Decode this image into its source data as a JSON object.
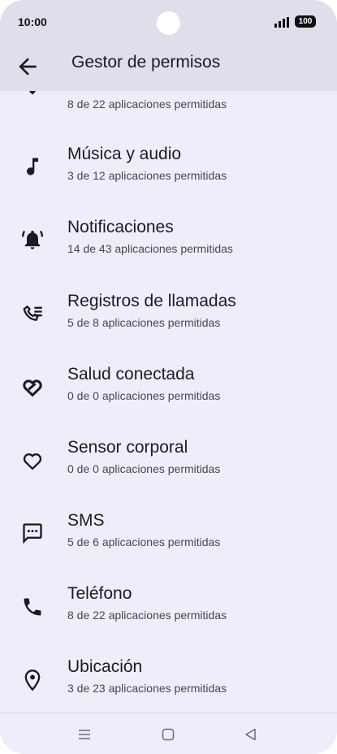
{
  "status_bar": {
    "time": "10:00",
    "battery": "100"
  },
  "app_bar": {
    "title": "Gestor de permisos"
  },
  "partial_item": {
    "subtitle": "8 de 22 aplicaciones permitidas"
  },
  "items": [
    {
      "title": "Música y audio",
      "subtitle": "3 de 12 aplicaciones permitidas",
      "icon": "music-note-icon"
    },
    {
      "title": "Notificaciones",
      "subtitle": "14 de 43 aplicaciones permitidas",
      "icon": "bell-icon"
    },
    {
      "title": "Registros de llamadas",
      "subtitle": "5 de 8 aplicaciones permitidas",
      "icon": "call-log-icon"
    },
    {
      "title": "Salud conectada",
      "subtitle": "0 de 0 aplicaciones permitidas",
      "icon": "health-connect-icon"
    },
    {
      "title": "Sensor corporal",
      "subtitle": "0 de 0 aplicaciones permitidas",
      "icon": "heart-icon"
    },
    {
      "title": "SMS",
      "subtitle": "5 de 6 aplicaciones permitidas",
      "icon": "sms-icon"
    },
    {
      "title": "Teléfono",
      "subtitle": "8 de 22 aplicaciones permitidas",
      "icon": "phone-icon"
    },
    {
      "title": "Ubicación",
      "subtitle": "3 de 23 aplicaciones permitidas",
      "icon": "location-icon"
    }
  ],
  "nav_bar": {
    "buttons": [
      "menu-icon",
      "home-icon",
      "back-triangle-icon"
    ]
  }
}
